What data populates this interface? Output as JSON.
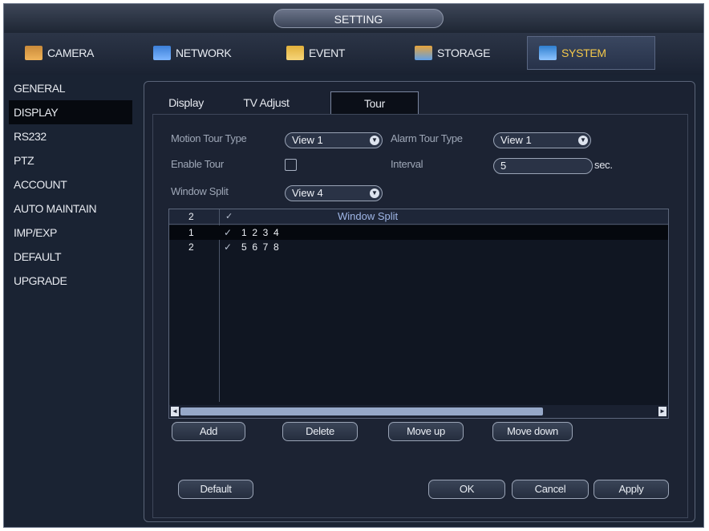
{
  "title": "SETTING",
  "top_tabs": [
    {
      "label": "CAMERA",
      "icon": "camera-icon"
    },
    {
      "label": "NETWORK",
      "icon": "network-icon"
    },
    {
      "label": "EVENT",
      "icon": "event-icon"
    },
    {
      "label": "STORAGE",
      "icon": "storage-icon"
    },
    {
      "label": "SYSTEM",
      "icon": "system-icon",
      "active": true
    }
  ],
  "sidebar": {
    "items": [
      {
        "label": "GENERAL"
      },
      {
        "label": "DISPLAY",
        "active": true
      },
      {
        "label": "RS232"
      },
      {
        "label": "PTZ"
      },
      {
        "label": "ACCOUNT"
      },
      {
        "label": "AUTO MAINTAIN"
      },
      {
        "label": "IMP/EXP"
      },
      {
        "label": "DEFAULT"
      },
      {
        "label": "UPGRADE"
      }
    ]
  },
  "sub_tabs": [
    {
      "label": "Display"
    },
    {
      "label": "TV Adjust"
    },
    {
      "label": "Tour",
      "active": true
    }
  ],
  "form": {
    "motion_tour_type_label": "Motion Tour Type",
    "motion_tour_type_value": "View 1",
    "alarm_tour_type_label": "Alarm Tour Type",
    "alarm_tour_type_value": "View 1",
    "enable_tour_label": "Enable Tour",
    "interval_label": "Interval",
    "interval_value": "5",
    "interval_unit": "sec.",
    "window_split_label": "Window Split",
    "window_split_value": "View 4"
  },
  "grid": {
    "header_count": "2",
    "header_title": "Window Split",
    "rows": [
      {
        "index": "1",
        "channels": "1  2  3  4"
      },
      {
        "index": "2",
        "channels": "5  6  7  8"
      }
    ]
  },
  "buttons": {
    "add": "Add",
    "delete": "Delete",
    "move_up": "Move up",
    "move_down": "Move down",
    "default": "Default",
    "ok": "OK",
    "cancel": "Cancel",
    "apply": "Apply"
  },
  "colors": {
    "active_tab_text": "#f4c84a",
    "background": "#1b2232"
  }
}
